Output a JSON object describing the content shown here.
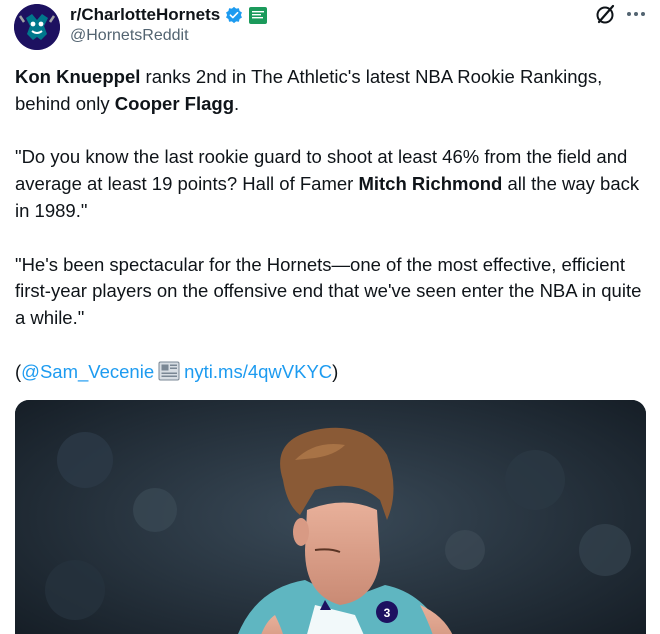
{
  "author": {
    "display_name": "r/CharlotteHornets",
    "handle": "@HornetsReddit"
  },
  "tweet": {
    "p1": {
      "name1": "Kon Knueppel",
      "text1": " ranks 2nd in The Athletic's latest NBA Rookie Rankings, behind only ",
      "name2": "Cooper Flagg",
      "text2": "."
    },
    "p2": {
      "text1": "\"Do you know the last rookie guard to shoot at least 46% from the field and average at least 19 points? Hall of Famer ",
      "name": "Mitch Richmond",
      "text2": " all the way back in 1989.\""
    },
    "p3": {
      "text": "\"He's been spectacular for the Hornets—one of the most effective, efficient first-year players on the offensive end that we've seen enter the NBA in quite a while.\""
    },
    "p4": {
      "open": "(",
      "mention": "@Sam_Vecenie",
      "link": "nyti.ms/4qwVKYC",
      "close": ")"
    }
  },
  "icons": {
    "verified": "verified-badge-icon",
    "affiliate": "affiliate-badge-icon",
    "grok": "grok-icon",
    "more": "more-icon",
    "news": "newspaper-icon"
  },
  "colors": {
    "link": "#1d9bf0",
    "verified": "#1d9bf0",
    "text": "#0f1419",
    "secondary": "#536471",
    "jersey_teal": "#5fb6c1"
  },
  "media": {
    "jersey_number": "3"
  }
}
